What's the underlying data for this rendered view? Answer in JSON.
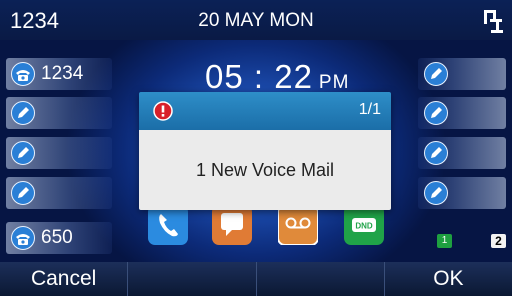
{
  "status_bar": {
    "extension": "1234",
    "date": "20 MAY MON",
    "icons": [
      "network-icon"
    ]
  },
  "clock": {
    "time": "05 : 22",
    "ampm": "PM"
  },
  "line_keys_left": [
    {
      "label": "1234",
      "icon": "phone-line-icon"
    },
    {
      "label": "",
      "icon": "speed-dial-icon"
    },
    {
      "label": "",
      "icon": "speed-dial-icon"
    },
    {
      "label": "",
      "icon": "speed-dial-icon"
    },
    {
      "label": "650",
      "icon": "phone-line-icon"
    }
  ],
  "line_keys_right": [
    {
      "label": "",
      "icon": "speed-dial-icon"
    },
    {
      "label": "",
      "icon": "speed-dial-icon"
    },
    {
      "label": "",
      "icon": "speed-dial-icon"
    },
    {
      "label": "",
      "icon": "speed-dial-icon"
    }
  ],
  "dock": [
    {
      "name": "phone-app-icon"
    },
    {
      "name": "message-app-icon"
    },
    {
      "name": "voicemail-app-icon"
    },
    {
      "name": "dnd-app-icon",
      "label": "DND"
    }
  ],
  "dialog": {
    "icon": "alert-icon",
    "page": "1/1",
    "message": "1 New Voice Mail"
  },
  "page_indicator": {
    "current": "1",
    "total": "2"
  },
  "softkeys": [
    "Cancel",
    "",
    "",
    "OK"
  ],
  "colors": {
    "dialog_header": "#1b6ea8",
    "dialog_body": "#ebebeb",
    "alert_red": "#d8202a",
    "dnd_green": "#1ea040"
  }
}
